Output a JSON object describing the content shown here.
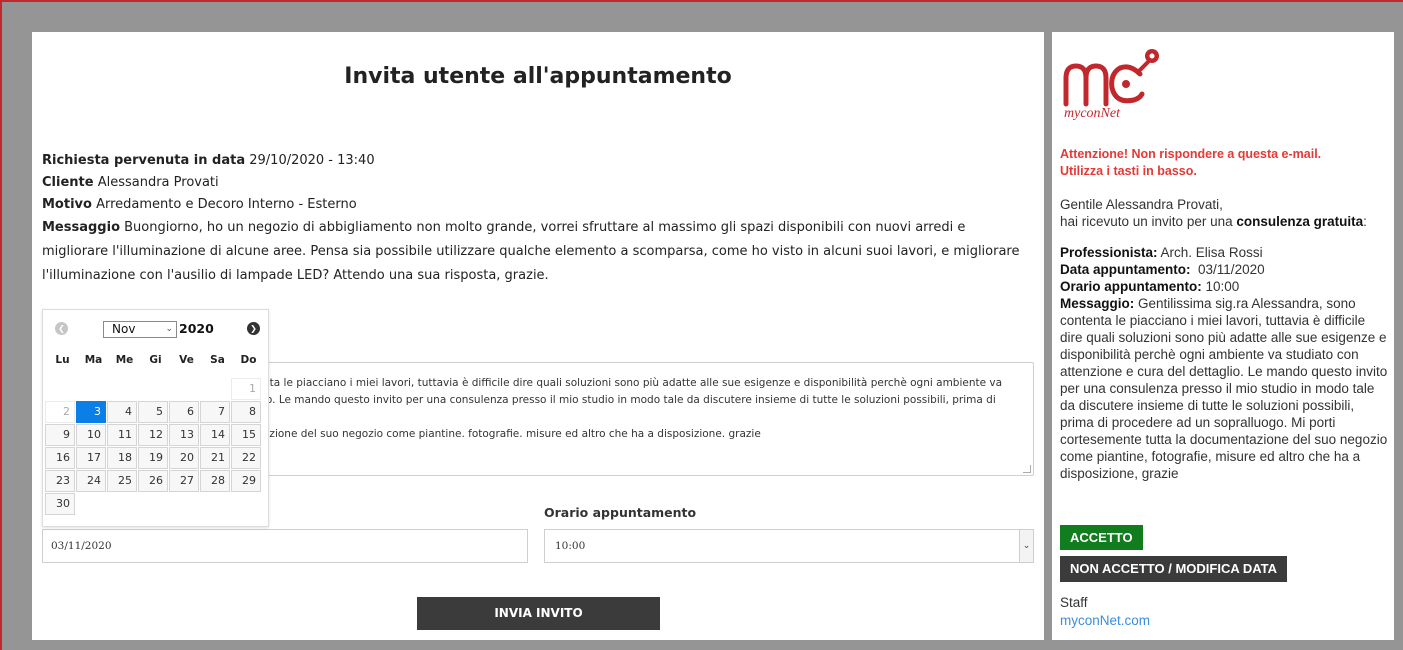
{
  "main": {
    "title": "Invita utente all'appuntamento",
    "request_label": "Richiesta pervenuta in data",
    "request_value": "29/10/2020 - 13:40",
    "client_label": "Cliente",
    "client_value": "Alessandra Provati",
    "reason_label": "Motivo",
    "reason_value": "Arredamento e Decoro Interno - Esterno",
    "message_label": "Messaggio",
    "message_value": "Buongiorno, ho un negozio di abbigliamento non molto grande, vorrei sfruttare al massimo gli spazi disponibili con nuovi arredi e migliorare l'illuminazione di alcune aree. Pensa sia possibile utilizzare qualche elemento a scomparsa, come ho visto in alcuni suoi lavori, e migliorare l'illuminazione con l'ausilio di lampade LED? Attendo una sua risposta, grazie.",
    "textarea_line1": "nta le piacciano i miei lavori, tuttavia è difficile dire quali soluzioni sono più adatte alle sue esigenze e disponibilità perchè ogni ambiente va",
    "textarea_line2": "io. Le mando questo invito per una consulenza presso il mio studio in modo tale da discutere insieme di tutte le soluzioni possibili, prima di",
    "textarea_line3": "azione del suo negozio come piantine. fotografie. misure ed altro che ha a disposizione. grazie",
    "time_label": "Orario appuntamento",
    "date_value": "03/11/2020",
    "time_value": "10:00",
    "send_label": "INVIA INVITO"
  },
  "datepicker": {
    "month": "Nov",
    "year": "2020",
    "weekdays": [
      "Lu",
      "Ma",
      "Me",
      "Gi",
      "Ve",
      "Sa",
      "Do"
    ],
    "days": [
      "1",
      "2",
      "3",
      "4",
      "5",
      "6",
      "7",
      "8",
      "9",
      "10",
      "11",
      "12",
      "13",
      "14",
      "15",
      "16",
      "17",
      "18",
      "19",
      "20",
      "21",
      "22",
      "23",
      "24",
      "25",
      "26",
      "27",
      "28",
      "29",
      "30"
    ],
    "selected_day": "3"
  },
  "side": {
    "logo_text": "myconNet",
    "warning_line1": "Attenzione! Non rispondere a questa e-mail.",
    "warning_line2": "Utilizza i tasti in basso.",
    "greeting": "Gentile  Alessandra Provati,",
    "invite_prefix": "hai ricevuto un invito per una",
    "invite_bold": "consulenza gratuita",
    "invite_suffix": ":",
    "professional_label": "Professionista:",
    "professional_value": "Arch. Elisa Rossi",
    "date_label": "Data appuntamento:",
    "date_value": "03/11/2020",
    "time_label": "Orario appuntamento:",
    "time_value": "10:00",
    "message_label": "Messaggio:",
    "message_value": "Gentilissima sig.ra Alessandra, sono contenta le piacciano i miei lavori, tuttavia è difficile dire quali soluzioni sono più adatte alle sue esigenze e disponibilità perchè ogni ambiente va studiato con attenzione e cura del dettaglio. Le mando questo invito per una consulenza presso il mio studio in modo tale da discutere insieme di tutte le soluzioni possibili, prima di procedere ad un sopralluogo. Mi porti cortesemente tutta la documentazione del suo negozio come piantine, fotografie, misure ed altro che ha a disposizione, grazie",
    "accept_label": "ACCETTO",
    "reject_label": "NON ACCETTO / MODIFICA DATA",
    "staff": "Staff",
    "site": "myconNet.com"
  },
  "colors": {
    "brand_red": "#c0282d",
    "accept_green": "#117d1e",
    "dark_button": "#3c3b3b",
    "selected_blue": "#0c7ee8",
    "warning_red": "#e53935",
    "link_blue": "#3a8ee0"
  }
}
